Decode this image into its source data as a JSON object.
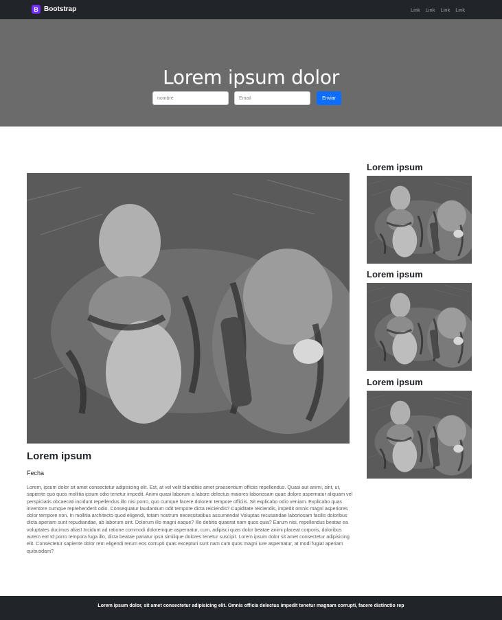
{
  "navbar": {
    "brand_badge": "B",
    "brand": "Bootstrap",
    "links": [
      "Link",
      "Link",
      "Link",
      "Link"
    ]
  },
  "hero": {
    "title": "Lorem ipsum dolor",
    "name_placeholder": "nombre",
    "email_placeholder": "Email",
    "submit_label": "Enviar"
  },
  "main": {
    "title": "Lorem ipsum",
    "date": "Fecha",
    "body": "Lorem, ipsum dolor sit amet consectetur adipisicing elit. Est, at vel velit blanditiis amet praesentium officiis repellendus. Quasi aut animi, sint, ut, sapiente quo quos mollitia ipsum odio tenetur impedit. Animi quasi laborum a labore delectus maiores laboriosam quae dolore aspernatur aliquam vel perspiciatis obcaecati incidunt repellendus illo nisi porro, quo cumque facere dolorem tempore officiis. Sit explicabo odio veniam. Explicabo quas inventore cumque reprehenderit odio. Consequatur laudantium odit tempore dicta reiciendis? Cupiditate reiciendis, impedit omnis magni asperiores dolor tempore non. In mollitia architecto quod eligendi, totam nostrum necessitatibus assumenda! Voluptas recusandae laboriosam facilis doloribus dicta aperiam sunt repudiandae, ab laborum sint. Dolorum illo magni eaque? Illo debitis quaerat nam quos quia? Earum nisi, repellendus beatae ea voluptates ducimus alias! Incidunt ad ratione commodi doloremque aspernatur, cum, adipisci quas dolor beatae animi placeat corporis, doloribus autem ea! Id porro tempora fuga illo, dicta beatae pariatur ipsa similique dolores tenetur suscipit. Lorem ipsum dolor sit amet consectetur adipisicing elit. Consectetur sapiente dolor rem eligendi rerum eos corrupti quas excepturi sunt nam cum quos magni iure aspernatur, at modi fugiat aperiam quibusdam?"
  },
  "sidebar": {
    "items": [
      {
        "title": "Lorem ipsum"
      },
      {
        "title": "Lorem ipsum"
      },
      {
        "title": "Lorem ipsum"
      }
    ]
  },
  "footer": {
    "text": "Lorem ipsum dolor, sit amet consectetur adipisicing elit. Omnis officia delectus impedit tenetur magnam corrupti, facere distinctio rep"
  }
}
